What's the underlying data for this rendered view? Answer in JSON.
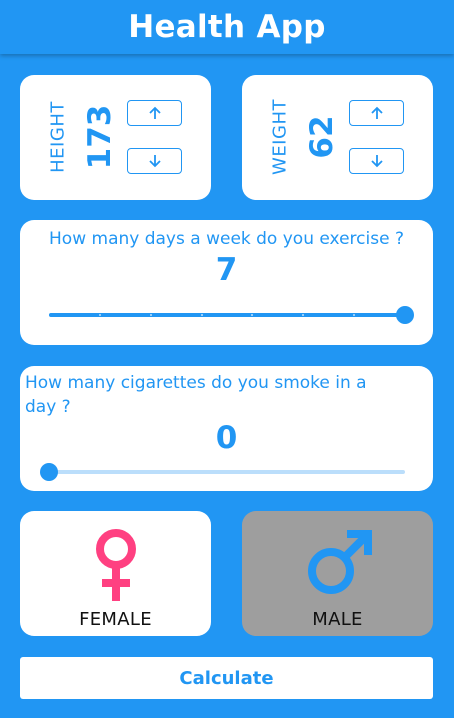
{
  "app": {
    "title": "Health App"
  },
  "height": {
    "label": "HEIGHT",
    "value": "173"
  },
  "weight": {
    "label": "WEIGHT",
    "value": "62"
  },
  "exercise": {
    "question": "How many days a week do you exercise ?",
    "value": "7",
    "min": 0,
    "max": 7,
    "level": 7,
    "divisions": 7
  },
  "smoking": {
    "question_line1": "How many cigarettes do you smoke in a",
    "question_line2": "day ?",
    "value": "0",
    "level_fraction": 0
  },
  "gender": {
    "female_label": "FEMALE",
    "male_label": "MALE",
    "selected": "male",
    "female_color": "#FF4081",
    "male_color": "#2196F3"
  },
  "calculate": {
    "label": "Calculate"
  },
  "colors": {
    "primary": "#2196F3",
    "selected_card": "#9E9E9E",
    "track_inactive": "#BBDEFB"
  },
  "icons": {
    "up": "arrow-up-icon",
    "down": "arrow-down-icon",
    "female": "female-icon",
    "male": "male-icon"
  }
}
